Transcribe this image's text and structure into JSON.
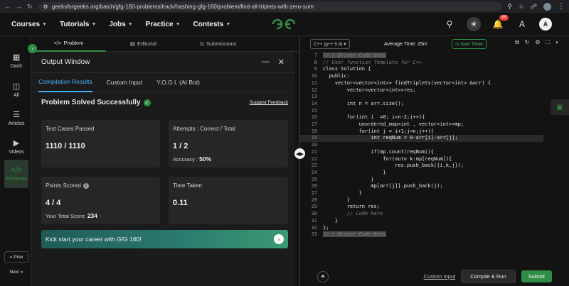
{
  "browser": {
    "url": "geeksforgeeks.org/batch/gfg-160-problems/track/hashing-gfg-160/problem/find-all-triplets-with-zero-sum"
  },
  "header": {
    "menu": [
      "Courses",
      "Tutorials",
      "Jobs",
      "Practice",
      "Contests"
    ],
    "logo_text": "GG",
    "notification_count": "85",
    "avatar_letter": "A"
  },
  "rail": {
    "items": [
      {
        "label": "Dash",
        "icon": "dashboard-icon"
      },
      {
        "label": "All",
        "icon": "grid-icon"
      },
      {
        "label": "Articles",
        "icon": "book-icon"
      },
      {
        "label": "Videos",
        "icon": "video-icon"
      },
      {
        "label": "Problems",
        "icon": "code-icon"
      }
    ],
    "prev_label": "Prev",
    "next_label": "Next"
  },
  "problem_tabs": [
    {
      "label": "Problem",
      "icon": "code-icon"
    },
    {
      "label": "Editorial",
      "icon": "document-icon"
    },
    {
      "label": "Submissions",
      "icon": "clock-icon"
    }
  ],
  "output": {
    "title": "Output Window",
    "tabs": [
      "Compilation Results",
      "Custom Input",
      "Y.O.G.I. (AI Bot)"
    ],
    "status": "Problem Solved Successfully",
    "feedback": "Suggest Feedback",
    "cards": {
      "tests_label": "Test Cases Passed",
      "tests_value": "1110 / 1110",
      "attempts_label": "Attempts : Correct / Total",
      "attempts_value": "1 / 2",
      "accuracy_label": "Accuracy :",
      "accuracy_value": "50%",
      "points_label": "Points Scored",
      "points_value": "4 / 4",
      "total_label": "Your Total Score:",
      "total_value": "234",
      "time_label": "Time Taken",
      "time_value": "0.11"
    },
    "promo": "Kick start your career with GfG 160!"
  },
  "editor": {
    "language": "C++ (g++ 5.4)",
    "avg_time": "Average Time: 25m",
    "timer": "Start Timer",
    "code": [
      {
        "n": "7",
        "t": "// } Driver Code Ends",
        "c": true,
        "hl": true
      },
      {
        "n": "8",
        "t": "// User function Template for C++",
        "c": true
      },
      {
        "n": "9",
        "t": "class Solution {"
      },
      {
        "n": "10",
        "t": "  public:"
      },
      {
        "n": "11",
        "t": "    vector<vector<int>> findTriplets(vector<int> &arr) {"
      },
      {
        "n": "12",
        "t": "        vector<vector<int>>res;"
      },
      {
        "n": "13",
        "t": ""
      },
      {
        "n": "14",
        "t": "        int n = arr.size();"
      },
      {
        "n": "15",
        "t": ""
      },
      {
        "n": "16",
        "t": "        for(int i  =0; i<n-2;i++){"
      },
      {
        "n": "17",
        "t": "            unordered_map<int , vector<int>>mp;"
      },
      {
        "n": "18",
        "t": "            for(int j = i+1;j<n;j++){"
      },
      {
        "n": "19",
        "t": "                int reqNum = 0-arr[i]-arr[j];",
        "cur": true
      },
      {
        "n": "20",
        "t": ""
      },
      {
        "n": "21",
        "t": "                if(mp.count(reqNum)){"
      },
      {
        "n": "22",
        "t": "                    for(auto k:mp[reqNum]){"
      },
      {
        "n": "23",
        "t": "                        res.push_back({i,k,j});"
      },
      {
        "n": "24",
        "t": "                    }"
      },
      {
        "n": "25",
        "t": "                }"
      },
      {
        "n": "26",
        "t": "                mp[arr[j]].push_back(j);"
      },
      {
        "n": "27",
        "t": "            }"
      },
      {
        "n": "28",
        "t": "        }"
      },
      {
        "n": "29",
        "t": "        return res;"
      },
      {
        "n": "30",
        "t": "        // Code here",
        "c": true
      },
      {
        "n": "31",
        "t": "    }"
      },
      {
        "n": "32",
        "t": "};"
      },
      {
        "n": "33",
        "t": "// } Driver Code Ends",
        "c": true,
        "hl": true
      }
    ],
    "custom_input": "Custom Input",
    "run": "Compile & Run",
    "submit": "Submit"
  }
}
